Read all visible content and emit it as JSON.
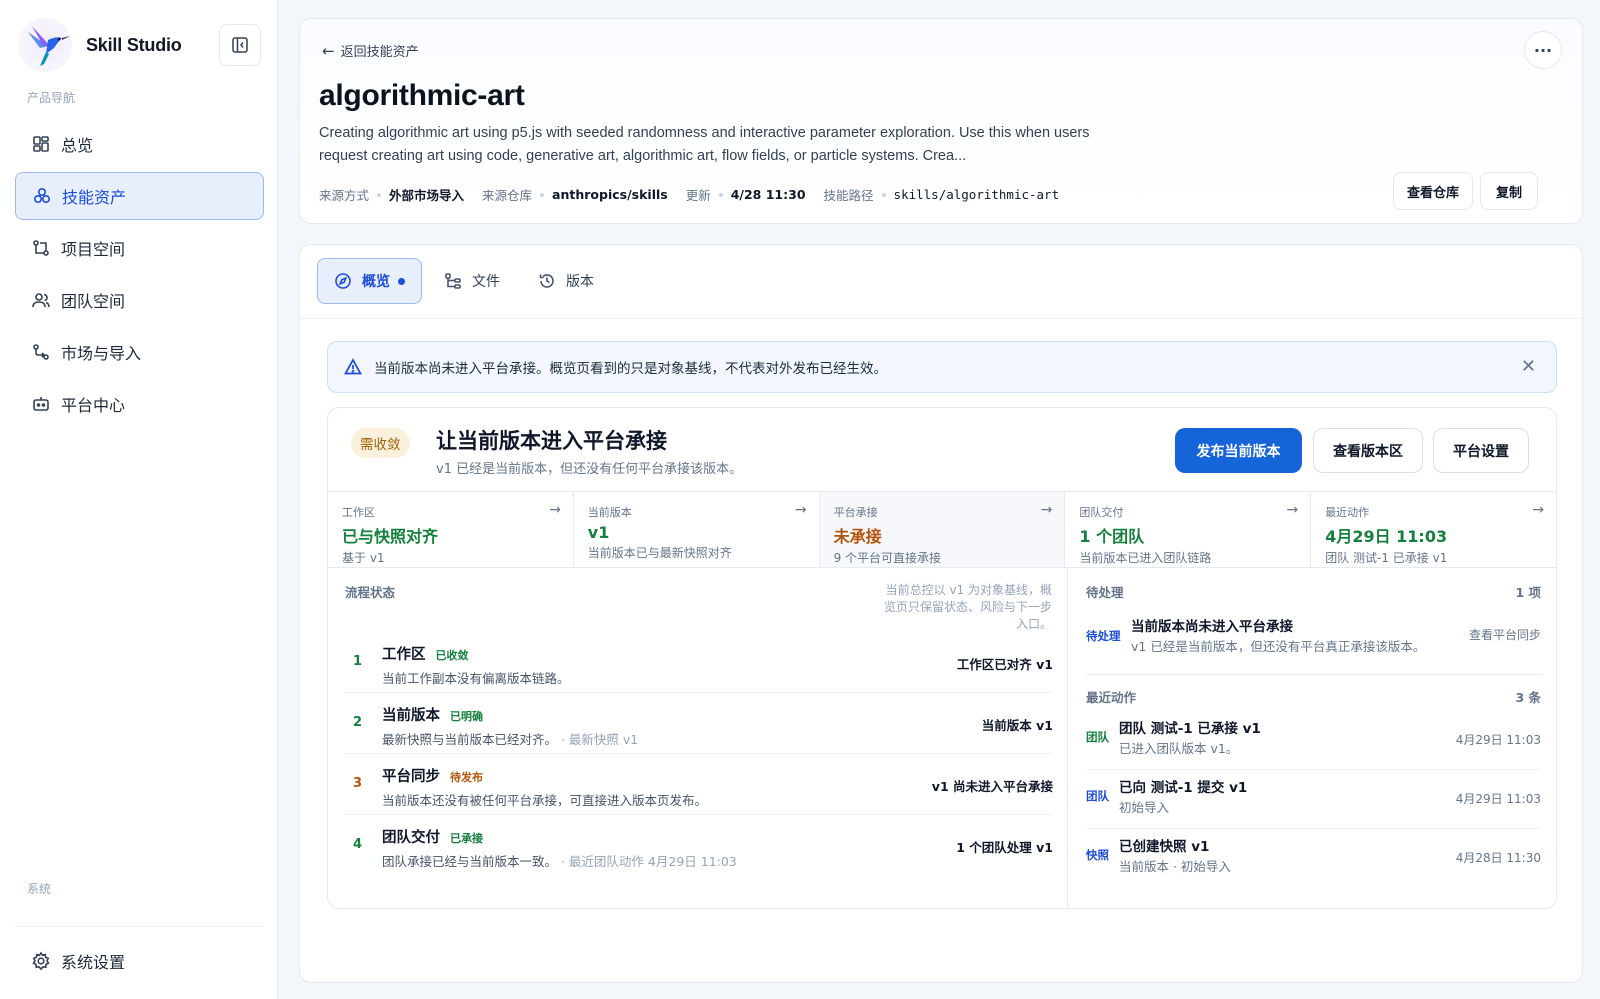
{
  "app": {
    "name": "Skill Studio"
  },
  "sidebar": {
    "product_heading": "产品导航",
    "system_heading": "系统",
    "items": [
      {
        "label": "总览",
        "icon": "dashboard-icon"
      },
      {
        "label": "技能资产",
        "icon": "skills-icon",
        "active": true
      },
      {
        "label": "项目空间",
        "icon": "project-icon"
      },
      {
        "label": "团队空间",
        "icon": "team-icon"
      },
      {
        "label": "市场与导入",
        "icon": "market-icon"
      },
      {
        "label": "平台中心",
        "icon": "platform-icon"
      }
    ],
    "settings": {
      "label": "系统设置",
      "icon": "gear-icon"
    }
  },
  "header": {
    "back_label": "返回技能资产",
    "title": "algorithmic-art",
    "description": "Creating algorithmic art using p5.js with seeded randomness and interactive parameter exploration. Use this when users request creating art using code, generative art, algorithmic art, flow fields, or particle systems. Crea...",
    "meta": [
      {
        "label": "来源方式",
        "value": "外部市场导入"
      },
      {
        "label": "来源仓库",
        "value": "anthropics/skills"
      },
      {
        "label": "更新",
        "value": "4/28 11:30"
      },
      {
        "label": "技能路径",
        "value": "skills/algorithmic-art",
        "mono": true
      }
    ],
    "view_repo_label": "查看仓库",
    "copy_label": "复制",
    "more_label": "···"
  },
  "tabs": [
    {
      "label": "概览",
      "icon": "compass-icon",
      "active": true
    },
    {
      "label": "文件",
      "icon": "files-icon"
    },
    {
      "label": "版本",
      "icon": "history-icon"
    }
  ],
  "alert": {
    "text": "当前版本尚未进入平台承接。概览页看到的只是对象基线，不代表对外发布已经生效。",
    "close": "✕"
  },
  "summary": {
    "badge": "需收敛",
    "title": "让当前版本进入平台承接",
    "subtitle": "v1 已经是当前版本，但还没有任何平台承接该版本。",
    "primary_btn": "发布当前版本",
    "versions_btn": "查看版本区",
    "settings_btn": "平台设置"
  },
  "stats": [
    {
      "label": "工作区",
      "value": "已与快照对齐",
      "sub": "基于 v1",
      "tone": "green"
    },
    {
      "label": "当前版本",
      "value": "v1",
      "sub": "当前版本已与最新快照对齐",
      "tone": "green"
    },
    {
      "label": "平台承接",
      "value": "未承接",
      "sub": "9 个平台可直接承接",
      "tone": "amber"
    },
    {
      "label": "团队交付",
      "value": "1 个团队",
      "sub": "当前版本已进入团队链路",
      "tone": "green"
    },
    {
      "label": "最近动作",
      "value": "4月29日 11:03",
      "sub": "团队 测试-1 已承接 v1",
      "tone": "green"
    }
  ],
  "flow": {
    "label": "流程状态",
    "note": "当前总控以 v1 为对象基线，概览页只保留状态、风险与下一步入口。",
    "steps": [
      {
        "num": "1",
        "title": "工作区",
        "tag": "已收敛",
        "tone": "green",
        "desc": "当前工作副本没有偏离版本链路。",
        "desc_muted": "",
        "right": "工作区已对齐 v1"
      },
      {
        "num": "2",
        "title": "当前版本",
        "tag": "已明确",
        "tone": "green",
        "desc": "最新快照与当前版本已经对齐。",
        "desc_muted": " · 最新快照 v1",
        "right": "当前版本 v1"
      },
      {
        "num": "3",
        "title": "平台同步",
        "tag": "待发布",
        "tone": "amber",
        "desc": "当前版本还没有被任何平台承接，可直接进入版本页发布。",
        "desc_muted": "",
        "right": "v1 尚未进入平台承接"
      },
      {
        "num": "4",
        "title": "团队交付",
        "tag": "已承接",
        "tone": "green",
        "desc": "团队承接已经与当前版本一致。",
        "desc_muted": " · 最近团队动作 4月29日 11:03",
        "right": "1 个团队处理 v1"
      }
    ]
  },
  "pending": {
    "label": "待处理",
    "count": "1 项",
    "item": {
      "tag": "待处理",
      "title": "当前版本尚未进入平台承接",
      "desc": "v1 已经是当前版本，但还没有平台真正承接该版本。",
      "link": "查看平台同步"
    }
  },
  "recent": {
    "label": "最近动作",
    "count": "3 条",
    "items": [
      {
        "tag": "团队",
        "tone": "green",
        "title": "团队 测试-1 已承接 v1",
        "desc": "已进入团队版本 v1。",
        "time": "4月29日 11:03"
      },
      {
        "tag": "团队",
        "tone": "blue",
        "title": "已向 测试-1 提交 v1",
        "desc": "初始导入",
        "time": "4月29日 11:03"
      },
      {
        "tag": "快照",
        "tone": "blue",
        "title": "已创建快照 v1",
        "desc": "当前版本 · 初始导入",
        "time": "4月28日 11:30"
      }
    ]
  }
}
